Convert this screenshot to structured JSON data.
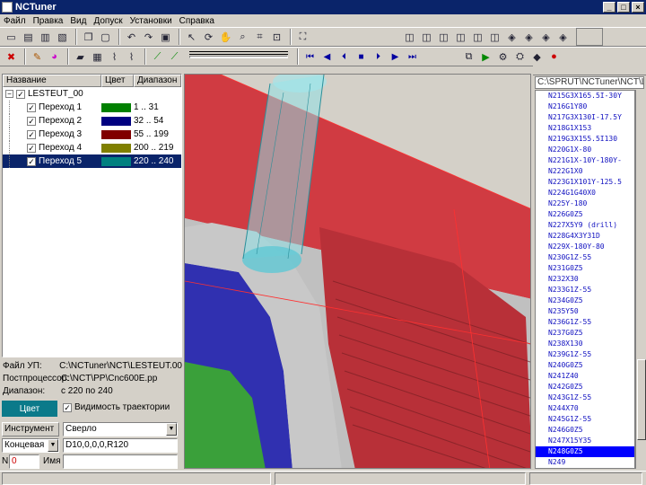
{
  "window": {
    "title": "NCTuner"
  },
  "menu": [
    "Файл",
    "Правка",
    "Вид",
    "Допуск",
    "Установки",
    "Справка"
  ],
  "tree": {
    "columns": [
      "Название",
      "Цвет",
      "Диапазон"
    ],
    "root": "LESTEUT_00",
    "items": [
      {
        "label": "Переход 1",
        "color": "#008000",
        "range": "1 .. 31"
      },
      {
        "label": "Переход 2",
        "color": "#000080",
        "range": "32 .. 54"
      },
      {
        "label": "Переход 3",
        "color": "#800000",
        "range": "55 .. 199"
      },
      {
        "label": "Переход 4",
        "color": "#808000",
        "range": "200 .. 219"
      },
      {
        "label": "Переход 5",
        "color": "#008080",
        "range": "220 .. 240"
      }
    ],
    "selected_index": 4
  },
  "props": {
    "file_label": "Файл УП:",
    "file_value": "C:\\NCTuner\\NCT\\LESTEUT.00",
    "postproc_label": "Постпроцессор:",
    "postproc_value": "C:\\NCT\\PP\\Cnc600E.pp",
    "range_label": "Диапазон:",
    "range_value": "с 220 по 240",
    "color_button": "Цвет",
    "trajectory_check": "Видимость траектории"
  },
  "tool": {
    "tool_label": "Инструмент",
    "tool_value": "Сверло",
    "type_value": "Концевая",
    "dims_value": "D10,0,0,0,R120",
    "n_label": "N",
    "n_value": "0",
    "name_label": "Имя",
    "name_value": ""
  },
  "program": {
    "path": "C:\\SPRUT\\NCTuner\\NCT\\LES",
    "lines": [
      "N215G3X165.5I-30Y",
      "N216G1Y80",
      "N217G3X130I-17.5Y",
      "N218G1X153",
      "N219G3X155.5I130",
      "N220G1X-80",
      "N221G1X-10Y-180Y-",
      "N222G1X0",
      "N223G1X101Y-125.5",
      "N224G1G40X0",
      "N225Y-180",
      "N226G0Z5",
      "N227X5Y9 (drill)",
      "N228G4X3Y31D",
      "N229X-180Y-80",
      "N230G1Z-55",
      "N231G0Z5",
      "N232X30",
      "N233G1Z-55",
      "N234G0Z5",
      "N235Y50",
      "N236G1Z-55",
      "N237G0Z5",
      "N238X130",
      "N239G1Z-55",
      "N240G0Z5",
      "N241Z40",
      "N242G0Z5",
      "N243G1Z-55",
      "N244X70",
      "N245G1Z-55",
      "N246G0Z5",
      "N247X15Y35",
      "N248G0Z5",
      "N249"
    ],
    "current_index": 33
  }
}
